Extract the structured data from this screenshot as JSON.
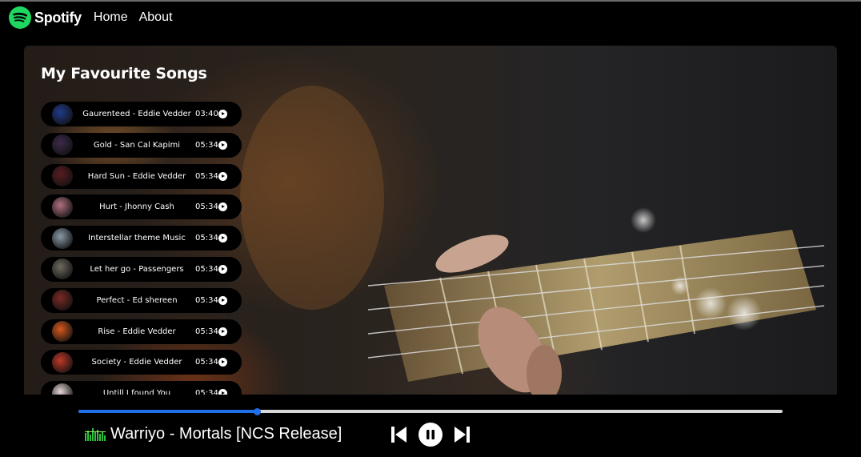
{
  "nav": {
    "brand": "Spotify",
    "links": [
      "Home",
      "About"
    ]
  },
  "playlist": {
    "heading": "My Favourite Songs",
    "songs": [
      {
        "name": "Gaurenteed - Eddie Vedder",
        "time": "03:40",
        "cover_color": "#1f3c8a"
      },
      {
        "name": "Gold - San Cal Kapimi",
        "time": "05:34",
        "cover_color": "#3d2a4a"
      },
      {
        "name": "Hard Sun - Eddie Vedder",
        "time": "05:34",
        "cover_color": "#5a1c20"
      },
      {
        "name": "Hurt - Jhonny Cash",
        "time": "05:34",
        "cover_color": "#b07080"
      },
      {
        "name": "Interstellar theme Music",
        "time": "05:34",
        "cover_color": "#8a9aa8"
      },
      {
        "name": "Let her go - Passengers",
        "time": "05:34",
        "cover_color": "#6e6a60"
      },
      {
        "name": "Perfect - Ed shereen",
        "time": "05:34",
        "cover_color": "#7a2a24"
      },
      {
        "name": "Rise - Eddie Vedder",
        "time": "05:34",
        "cover_color": "#d8581c"
      },
      {
        "name": "Society - Eddie Vedder",
        "time": "05:34",
        "cover_color": "#c03828"
      },
      {
        "name": "Untill I found You",
        "time": "05:34",
        "cover_color": "#e8d8d8"
      }
    ]
  },
  "player": {
    "now_playing": "Warriyo - Mortals [NCS Release]",
    "progress_fraction": 0.253,
    "accent_color": "#1e6fe8",
    "brand_color": "#1ed760",
    "icons": [
      "spotify-logo-icon",
      "equalizer-icon",
      "previous-icon",
      "pause-icon",
      "next-icon",
      "play-icon"
    ]
  }
}
